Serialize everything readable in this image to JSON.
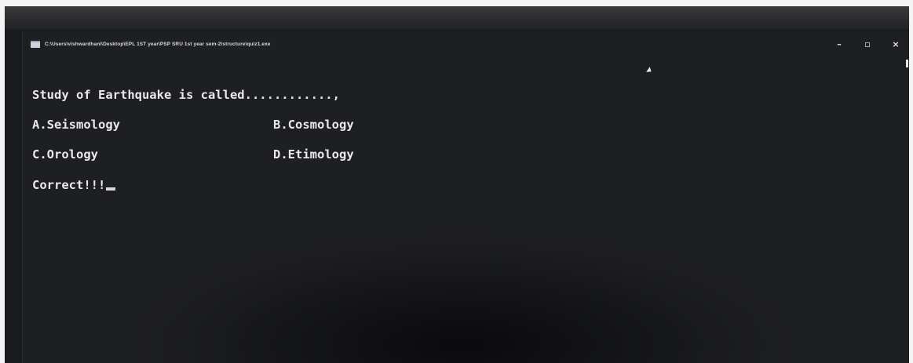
{
  "window": {
    "title": "C:\\Users\\vishwardhani\\Desktop\\EPL 1ST year\\PSP SRU 1st year sem-2\\structure\\quiz1.exe",
    "controls": {
      "minimize": "–",
      "maximize": "▫",
      "close": "×"
    }
  },
  "console": {
    "question": "Study of Earthquake is called............,",
    "options": [
      {
        "text": "A.Seismology"
      },
      {
        "text": "B.Cosmology"
      },
      {
        "text": "C.Orology"
      },
      {
        "text": "D.Etimology"
      }
    ],
    "result": "Correct!!!"
  },
  "colors": {
    "console_background": "#1a1b1f",
    "console_text": "#e9e9ea",
    "page_background": "#f4f4f4"
  }
}
